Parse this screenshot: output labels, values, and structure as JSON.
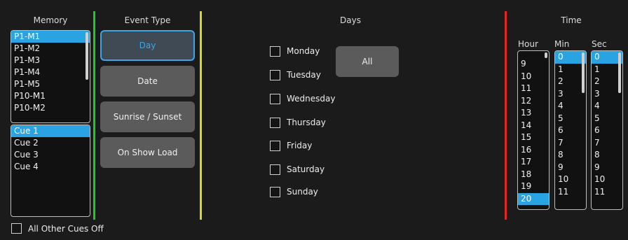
{
  "memory": {
    "title": "Memory",
    "items": [
      "P1-M1",
      "P1-M2",
      "P1-M3",
      "P1-M4",
      "P1-M5",
      "P10-M1",
      "P10-M2"
    ],
    "selected_index": 0
  },
  "cues": {
    "items": [
      "Cue 1",
      "Cue 2",
      "Cue 3",
      "Cue 4"
    ],
    "selected_index": 0
  },
  "event_type": {
    "title": "Event Type",
    "buttons": [
      {
        "label": "Day",
        "active": true
      },
      {
        "label": "Date",
        "active": false
      },
      {
        "label": "Sunrise / Sunset",
        "active": false
      },
      {
        "label": "On Show Load",
        "active": false
      }
    ]
  },
  "days": {
    "title": "Days",
    "all_label": "All",
    "items": [
      "Monday",
      "Tuesday",
      "Wednesday",
      "Thursday",
      "Friday",
      "Saturday",
      "Sunday"
    ]
  },
  "time": {
    "title": "Time",
    "hour_label": "Hour",
    "min_label": "Min",
    "sec_label": "Sec",
    "hours": [
      "9",
      "10",
      "11",
      "12",
      "13",
      "14",
      "15",
      "16",
      "17",
      "18",
      "19",
      "20"
    ],
    "hour_selected": "20",
    "minutes": [
      "0",
      "1",
      "2",
      "3",
      "4",
      "5",
      "6",
      "7",
      "8",
      "9",
      "10",
      "11"
    ],
    "minute_selected": "0",
    "seconds": [
      "0",
      "1",
      "2",
      "3",
      "4",
      "5",
      "6",
      "7",
      "8",
      "9",
      "10",
      "11"
    ],
    "second_selected": "0"
  },
  "footer": {
    "all_other_cues_off_label": "All Other Cues Off"
  },
  "colors": {
    "selection": "#2aa3e3",
    "separator_memory": "#22c922",
    "separator_event": "#d8d81e",
    "separator_time": "#e02525"
  }
}
